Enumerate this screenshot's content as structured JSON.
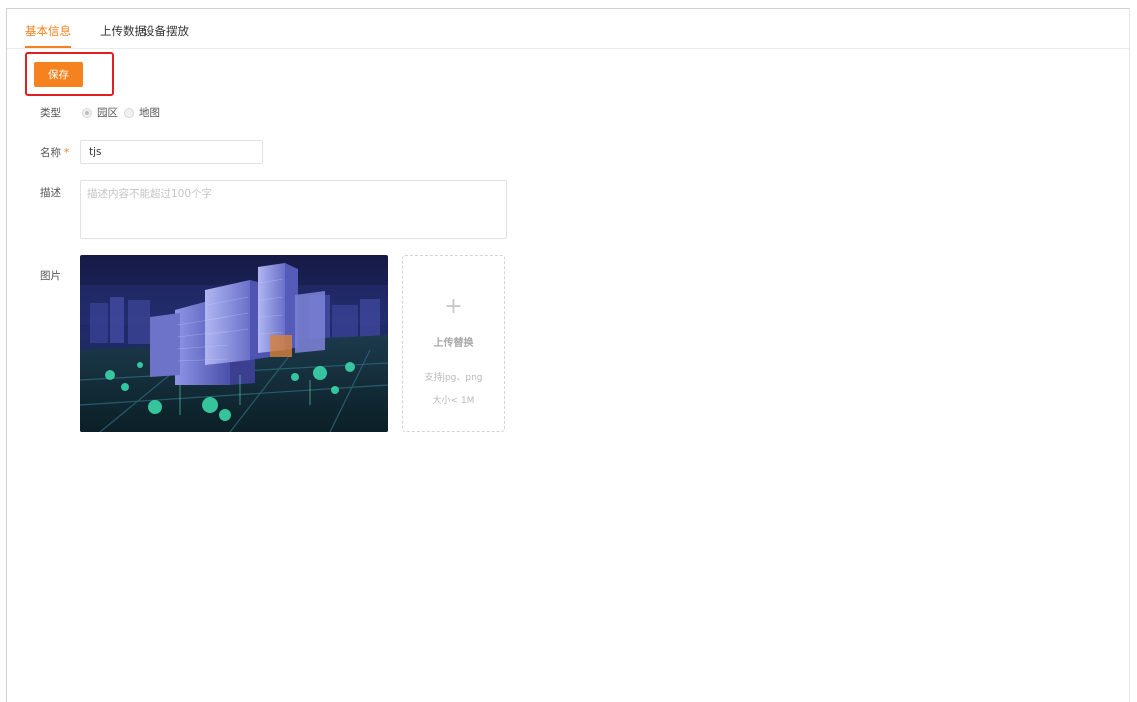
{
  "tabs": [
    {
      "label": "基本信息",
      "active": true
    },
    {
      "label": "上传数据",
      "active": false
    },
    {
      "label": "设备摆放",
      "active": false
    }
  ],
  "toolbar": {
    "save_label": "保存"
  },
  "form": {
    "type_label": "类型",
    "type_options": [
      {
        "label": "园区",
        "checked": true
      },
      {
        "label": "地图",
        "checked": false
      }
    ],
    "name_label": "名称",
    "name_required_mark": "*",
    "name_value": "tjs",
    "desc_label": "描述",
    "desc_placeholder": "描述内容不能超过100个字",
    "image_label": "图片"
  },
  "upload": {
    "plus_icon": "plus-icon",
    "title": "上传替换",
    "hint_format": "支持jpg、png",
    "hint_size": "大小< 1M"
  },
  "colors": {
    "accent": "#f5821f",
    "highlight_border": "#e02020"
  }
}
